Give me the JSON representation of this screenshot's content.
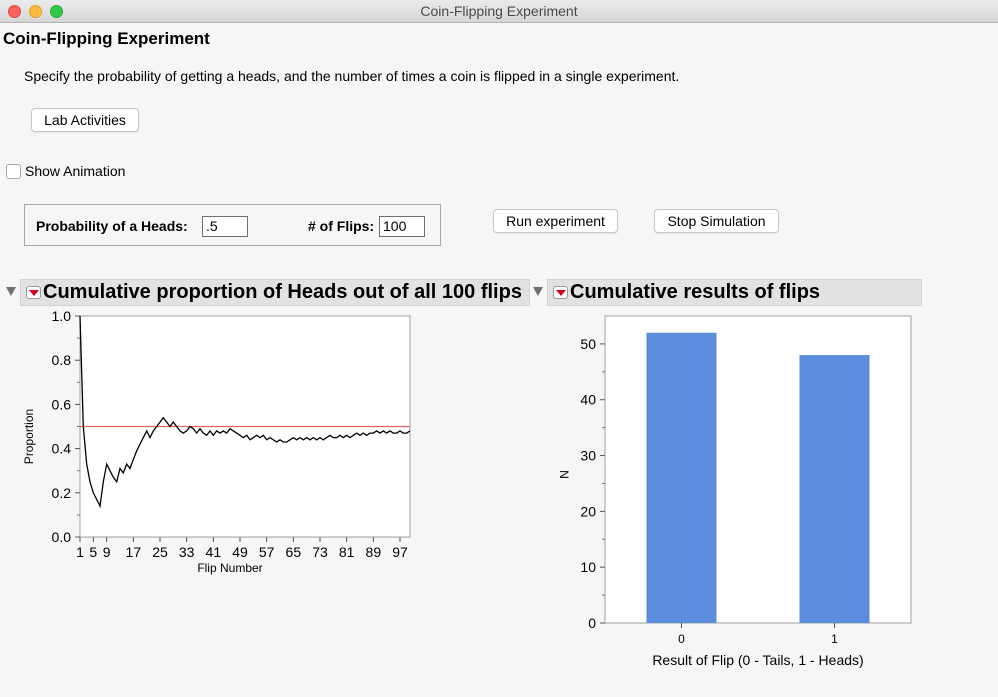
{
  "window": {
    "title": "Coin-Flipping Experiment"
  },
  "app": {
    "title": "Coin-Flipping Experiment",
    "description": "Specify the probability of getting a heads, and the number of times a coin is flipped in a single experiment."
  },
  "buttons": {
    "lab_activities": "Lab Activities",
    "run_experiment": "Run experiment",
    "stop_simulation": "Stop Simulation"
  },
  "show_animation": {
    "label": "Show Animation",
    "checked": false
  },
  "params": {
    "probability_label": "Probability of a Heads:",
    "probability_value": ".5",
    "flips_label": "# of Flips:",
    "flips_value": "100"
  },
  "icons": [
    "disclosure-triangle-icon",
    "red-triangle-menu-icon"
  ],
  "colors": {
    "line": "#000000",
    "reference_line": "#e06666",
    "bar": "#5b8ddc"
  },
  "left_panel": {
    "title": "Cumulative proportion of Heads out of all 100 flips"
  },
  "right_panel": {
    "title": "Cumulative results of flips"
  },
  "chart_data": [
    {
      "type": "line",
      "title": "Cumulative proportion of Heads out of all 100 flips",
      "xlabel": "Flip Number",
      "ylabel": "Proportion",
      "xlim": [
        1,
        100
      ],
      "ylim": [
        0,
        1
      ],
      "x_ticks": [
        "1",
        "5",
        "9",
        "17",
        "25",
        "33",
        "41",
        "49",
        "57",
        "65",
        "73",
        "81",
        "89",
        "97"
      ],
      "y_ticks": [
        "0.0",
        "0.2",
        "0.4",
        "0.6",
        "0.8",
        "1.0"
      ],
      "reference_line": 0.5,
      "grid": false,
      "x": [
        1,
        2,
        3,
        4,
        5,
        6,
        7,
        8,
        9,
        10,
        11,
        12,
        13,
        14,
        15,
        16,
        17,
        18,
        19,
        20,
        21,
        22,
        23,
        24,
        25,
        26,
        27,
        28,
        29,
        30,
        31,
        32,
        33,
        34,
        35,
        36,
        37,
        38,
        39,
        40,
        41,
        42,
        43,
        44,
        45,
        46,
        47,
        48,
        49,
        50,
        51,
        52,
        53,
        54,
        55,
        56,
        57,
        58,
        59,
        60,
        61,
        62,
        63,
        64,
        65,
        66,
        67,
        68,
        69,
        70,
        71,
        72,
        73,
        74,
        75,
        76,
        77,
        78,
        79,
        80,
        81,
        82,
        83,
        84,
        85,
        86,
        87,
        88,
        89,
        90,
        91,
        92,
        93,
        94,
        95,
        96,
        97,
        98,
        99,
        100
      ],
      "y": [
        1.0,
        0.5,
        0.33,
        0.25,
        0.2,
        0.17,
        0.14,
        0.25,
        0.33,
        0.3,
        0.27,
        0.25,
        0.31,
        0.29,
        0.33,
        0.31,
        0.35,
        0.39,
        0.42,
        0.45,
        0.48,
        0.45,
        0.48,
        0.5,
        0.52,
        0.54,
        0.52,
        0.5,
        0.52,
        0.5,
        0.48,
        0.47,
        0.48,
        0.5,
        0.49,
        0.47,
        0.49,
        0.47,
        0.46,
        0.48,
        0.46,
        0.48,
        0.47,
        0.48,
        0.47,
        0.49,
        0.48,
        0.47,
        0.46,
        0.45,
        0.46,
        0.44,
        0.45,
        0.46,
        0.45,
        0.46,
        0.44,
        0.45,
        0.44,
        0.43,
        0.44,
        0.43,
        0.43,
        0.44,
        0.45,
        0.44,
        0.45,
        0.44,
        0.45,
        0.44,
        0.45,
        0.44,
        0.45,
        0.44,
        0.45,
        0.46,
        0.45,
        0.45,
        0.46,
        0.45,
        0.46,
        0.45,
        0.46,
        0.47,
        0.46,
        0.47,
        0.46,
        0.47,
        0.47,
        0.48,
        0.47,
        0.48,
        0.47,
        0.48,
        0.47,
        0.47,
        0.48,
        0.47,
        0.47,
        0.48
      ]
    },
    {
      "type": "bar",
      "title": "Cumulative results of flips",
      "xlabel": "Result of Flip (0 - Tails, 1 - Heads)",
      "ylabel": "N",
      "categories": [
        "0",
        "1"
      ],
      "values": [
        52,
        48
      ],
      "ylim": [
        0,
        55
      ],
      "y_ticks": [
        "0",
        "10",
        "20",
        "30",
        "40",
        "50"
      ],
      "grid": false
    }
  ]
}
